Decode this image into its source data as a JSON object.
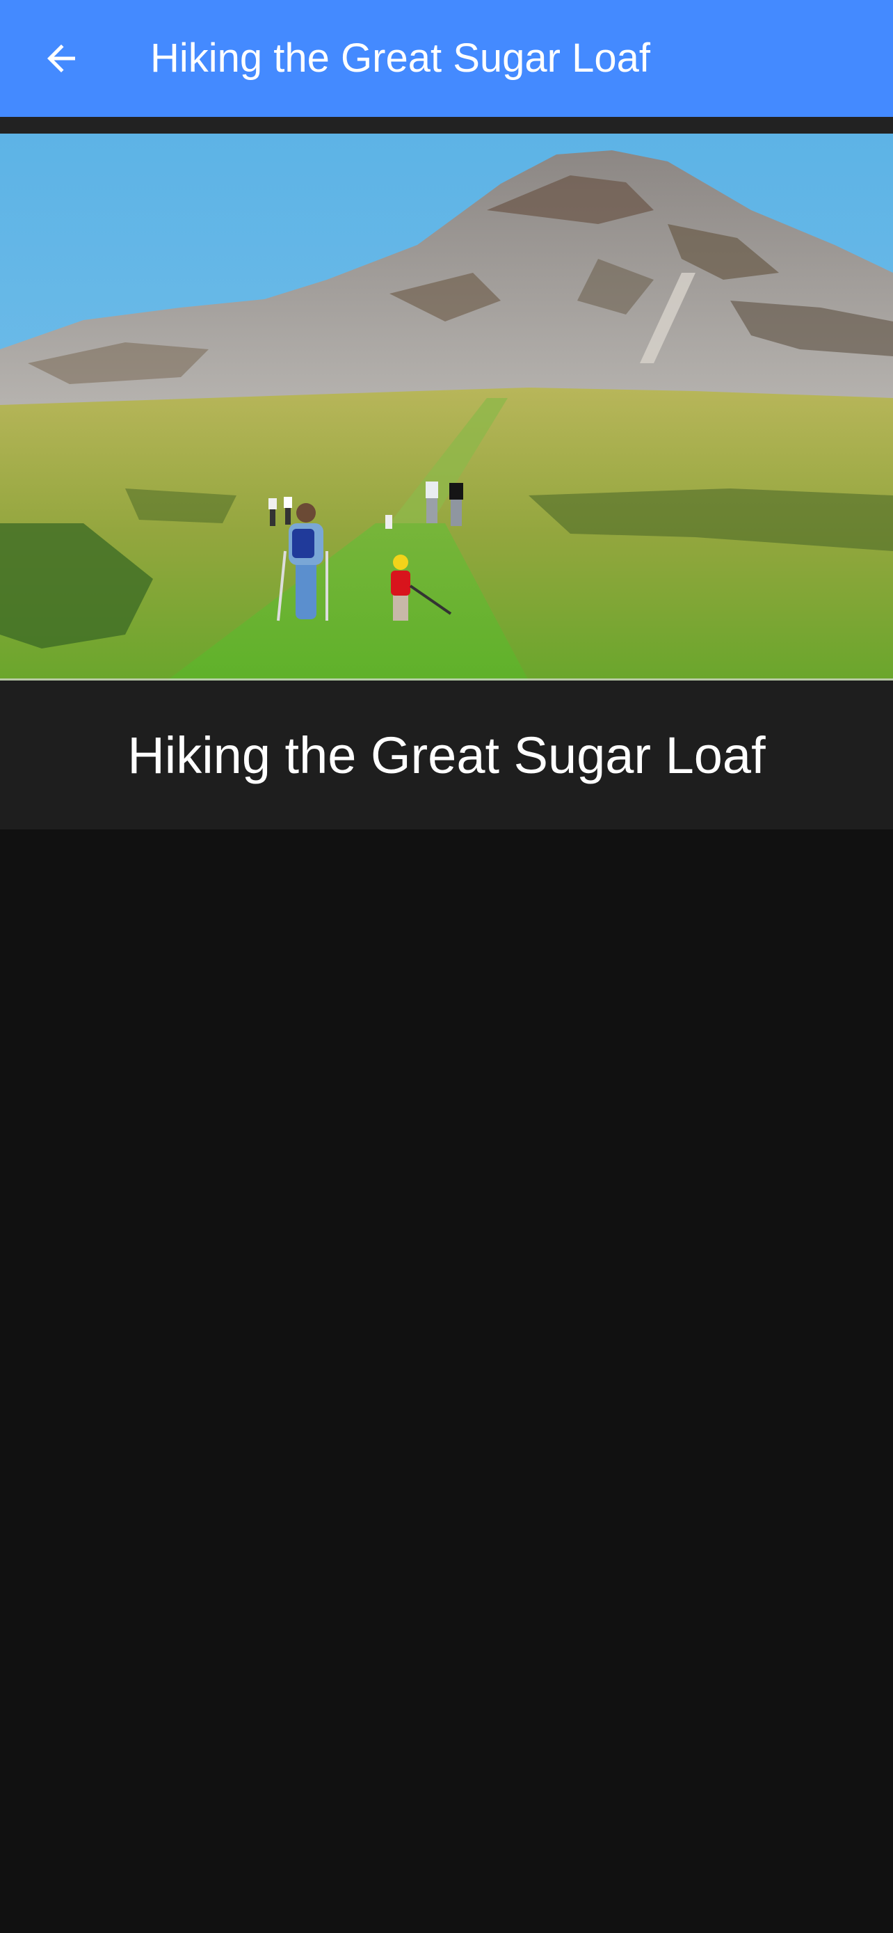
{
  "app_bar": {
    "title": "Hiking the Great Sugar Loaf",
    "back_icon": "arrow-back-icon",
    "color": "#448AFF"
  },
  "hero": {
    "subject": "Great Sugar Loaf mountain with hikers on a grassy trail"
  },
  "caption": {
    "title": "Hiking the Great Sugar Loaf"
  },
  "colors": {
    "background": "#111111",
    "caption_background": "#1e1e1e",
    "text": "#ffffff"
  }
}
